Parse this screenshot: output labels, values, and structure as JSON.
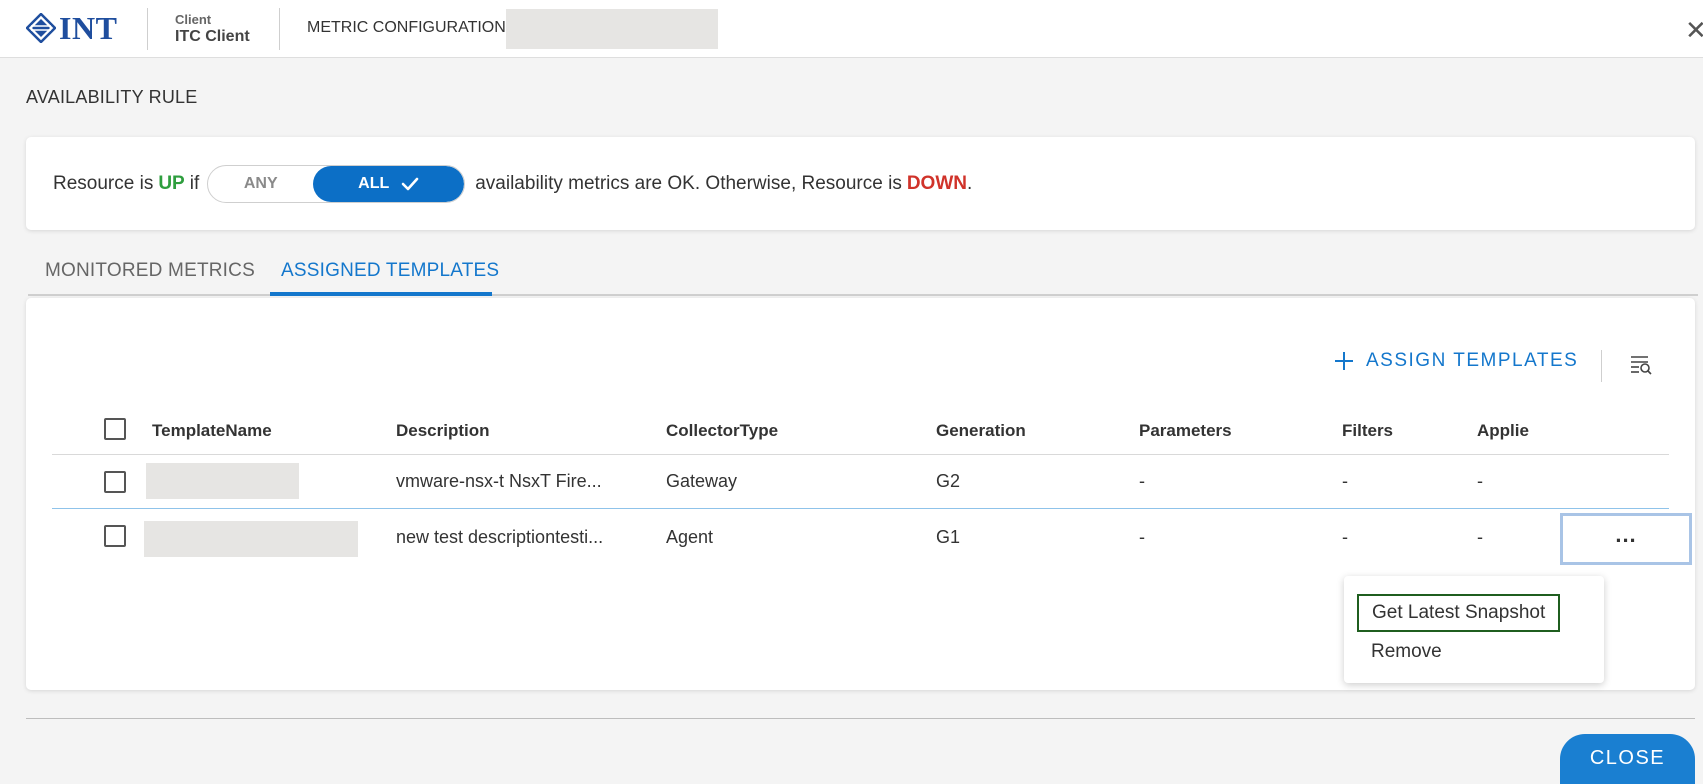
{
  "header": {
    "logo_text": "INT",
    "client_label": "Client",
    "client_name": "ITC Client",
    "page_heading": "METRIC CONFIGURATION -"
  },
  "availability_rule": {
    "section_title": "AVAILABILITY RULE",
    "prefix": "Resource is",
    "up": "UP",
    "if": "if",
    "toggle": {
      "any": "ANY",
      "all": "ALL",
      "selected": "ALL"
    },
    "middle": "availability metrics are OK. Otherwise, Resource is",
    "down": "DOWN",
    "suffix": "."
  },
  "tabs": [
    {
      "label": "MONITORED METRICS",
      "active": false
    },
    {
      "label": "ASSIGNED TEMPLATES",
      "active": true
    }
  ],
  "toolbar": {
    "assign_label": "ASSIGN TEMPLATES"
  },
  "table": {
    "columns": [
      "TemplateName",
      "Description",
      "CollectorType",
      "Generation",
      "Parameters",
      "Filters",
      "Applie"
    ],
    "rows": [
      {
        "name": "",
        "description": "vmware-nsx-t NsxT Fire...",
        "collector_type": "Gateway",
        "generation": "G2",
        "parameters": "-",
        "filters": "-",
        "applied": "-"
      },
      {
        "name": "",
        "description": "new test descriptiontesti...",
        "collector_type": "Agent",
        "generation": "G1",
        "parameters": "-",
        "filters": "-",
        "applied": "-"
      }
    ]
  },
  "row_actions": {
    "more_label": "..."
  },
  "context_menu": {
    "items": [
      "Get Latest Snapshot",
      "Remove"
    ]
  },
  "footer": {
    "close_label": "CLOSE"
  },
  "colors": {
    "primary": "#1477cc",
    "up": "#2e9e3e",
    "down": "#d0332a",
    "logo": "#1f4e9e"
  }
}
